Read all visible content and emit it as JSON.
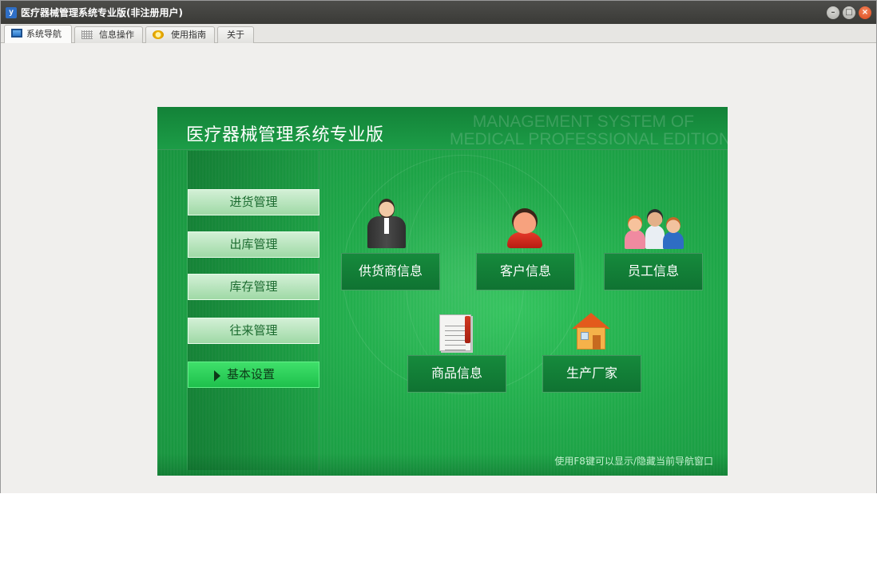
{
  "window": {
    "title": "医疗器械管理系统专业版(非注册用户)",
    "app_icon_text": "y"
  },
  "tabs": [
    {
      "label": "系统导航",
      "icon": "monitor-icon",
      "active": true
    },
    {
      "label": "信息操作",
      "icon": "grid-icon",
      "active": false
    },
    {
      "label": "使用指南",
      "icon": "help-icon",
      "active": false
    },
    {
      "label": "关于",
      "icon": "",
      "active": false
    }
  ],
  "panel": {
    "title": "医疗器械管理系统专业版",
    "english_line1": "MANAGEMENT SYSTEM OF",
    "english_line2": "MEDICAL PROFESSIONAL EDITION",
    "hint": "使用F8键可以显示/隐藏当前导航窗口"
  },
  "menu": [
    {
      "label": "进货管理",
      "active": false
    },
    {
      "label": "出库管理",
      "active": false
    },
    {
      "label": "库存管理",
      "active": false
    },
    {
      "label": "往来管理",
      "active": false
    },
    {
      "label": "基本设置",
      "active": true
    }
  ],
  "tiles": [
    {
      "label": "供货商信息",
      "icon": "supplier-icon"
    },
    {
      "label": "客户信息",
      "icon": "customer-icon"
    },
    {
      "label": "员工信息",
      "icon": "employee-icon"
    },
    {
      "label": "商品信息",
      "icon": "product-icon"
    },
    {
      "label": "生产厂家",
      "icon": "manufacturer-icon"
    }
  ],
  "colors": {
    "panel_green": "#1ea648",
    "tile_green": "#128035",
    "active_menu": "#2fd45c"
  }
}
